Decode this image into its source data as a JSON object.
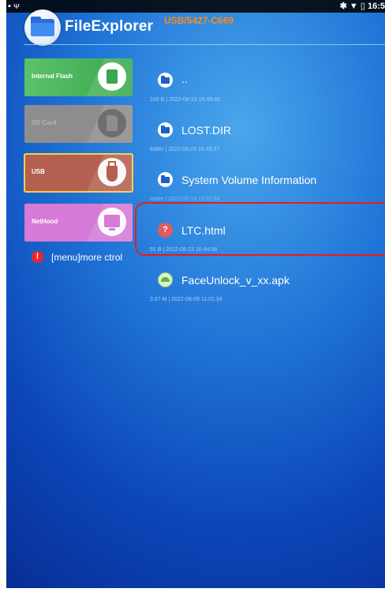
{
  "status_bar": {
    "time": "16:5",
    "icons": [
      "notification-icon",
      "usb-icon",
      "bluetooth-icon",
      "wifi-icon",
      "battery-icon"
    ]
  },
  "header": {
    "title": "FileExplorer",
    "path": "USB/5427-C669"
  },
  "sidebar": {
    "tiles": [
      {
        "label": "Internal Flash",
        "icon": "chip-icon",
        "color": "#4cb85c"
      },
      {
        "label": "SD Card",
        "icon": "sd-card-icon",
        "color": "#8d8d8d"
      },
      {
        "label": "USB",
        "icon": "usb-drive-icon",
        "color": "#b36050",
        "selected": true
      },
      {
        "label": "NetHood",
        "icon": "monitor-icon",
        "color": "#d57ad6"
      }
    ],
    "menu_hint": {
      "icon": "!",
      "text": "[menu]more ctrol"
    }
  },
  "files": [
    {
      "name": "..",
      "meta": "100 B | 2022-08-23 16:49:40",
      "icon": "folder-icon"
    },
    {
      "name": "LOST.DIR",
      "meta": "folder | 2022-08-23 16:49:37",
      "icon": "folder-icon"
    },
    {
      "name": "System Volume Information",
      "meta": "folder | 2022-07-19 12:01:56",
      "icon": "folder-icon"
    },
    {
      "name": "LTC.html",
      "meta": "51 B | 2022-08-23 16:44:08",
      "icon": "html-file-icon",
      "icon_glyph": "?"
    },
    {
      "name": "FaceUnlock_v_xx.apk",
      "meta": "3.87 M | 2022-08-09 11:01:34",
      "icon": "apk-file-icon"
    }
  ],
  "colors": {
    "accent_path": "#ff8a1a",
    "highlight": "#e81c1c",
    "selected_outline": "#f2d24a"
  }
}
